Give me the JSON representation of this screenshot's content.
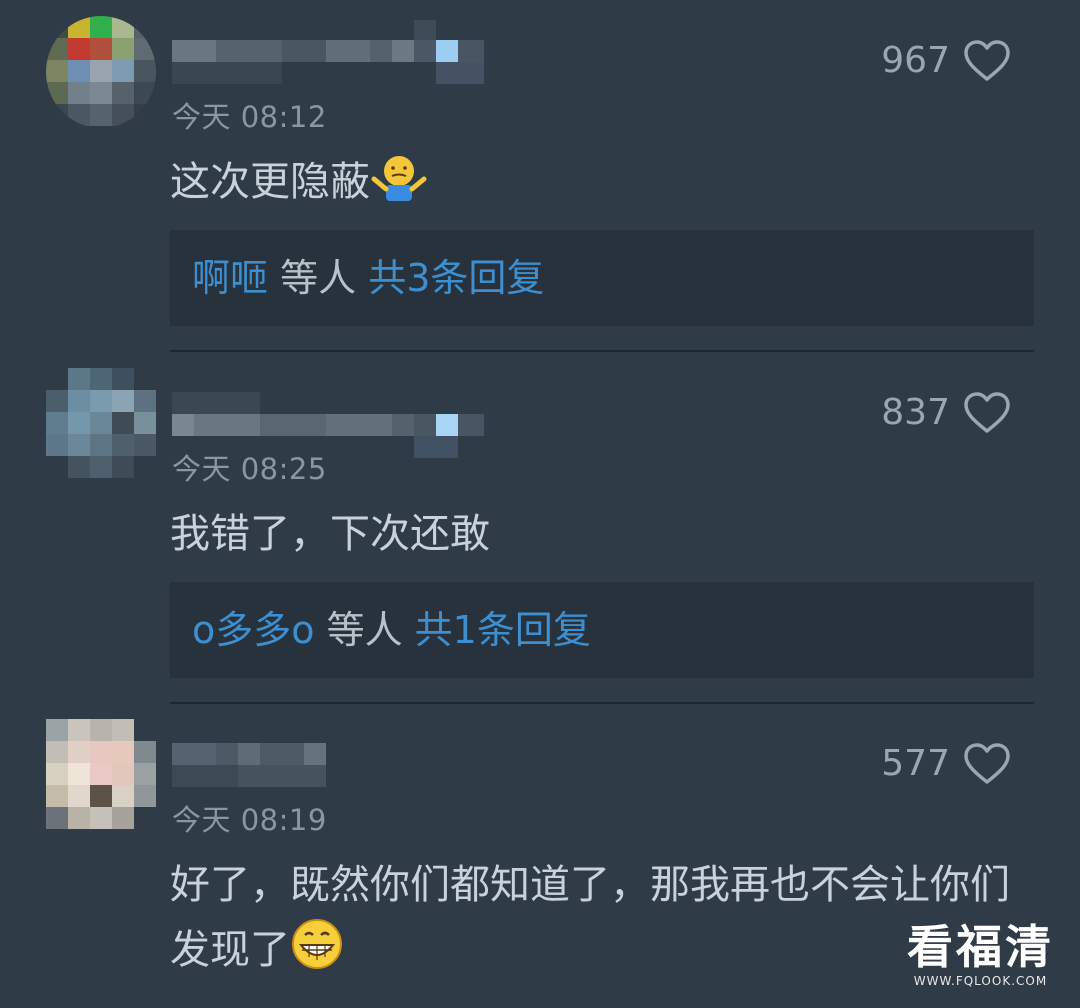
{
  "comments": [
    {
      "time": "今天 08:12",
      "likes": "967",
      "text": "这次更隐蔽",
      "emoji": "shrug-emoji",
      "reply_names": "啊咂",
      "reply_mid": " 等人 ",
      "reply_count": "共3条回复"
    },
    {
      "time": "今天 08:25",
      "likes": "837",
      "text": "我错了，下次还敢",
      "reply_names": "o多多o",
      "reply_mid": " 等人 ",
      "reply_count": "共1条回复"
    },
    {
      "time": "今天 08:19",
      "likes": "577",
      "text": "好了，既然你们都知道了，那我再也不会让你们发现了",
      "emoji": "grin-emoji"
    }
  ],
  "watermark": {
    "title": "看福清",
    "url": "WWW.FQLOOK.COM"
  },
  "colors": {
    "background": "#2f3b46",
    "link_blue": "#3d8fd0",
    "reply_box": "#27323c"
  }
}
